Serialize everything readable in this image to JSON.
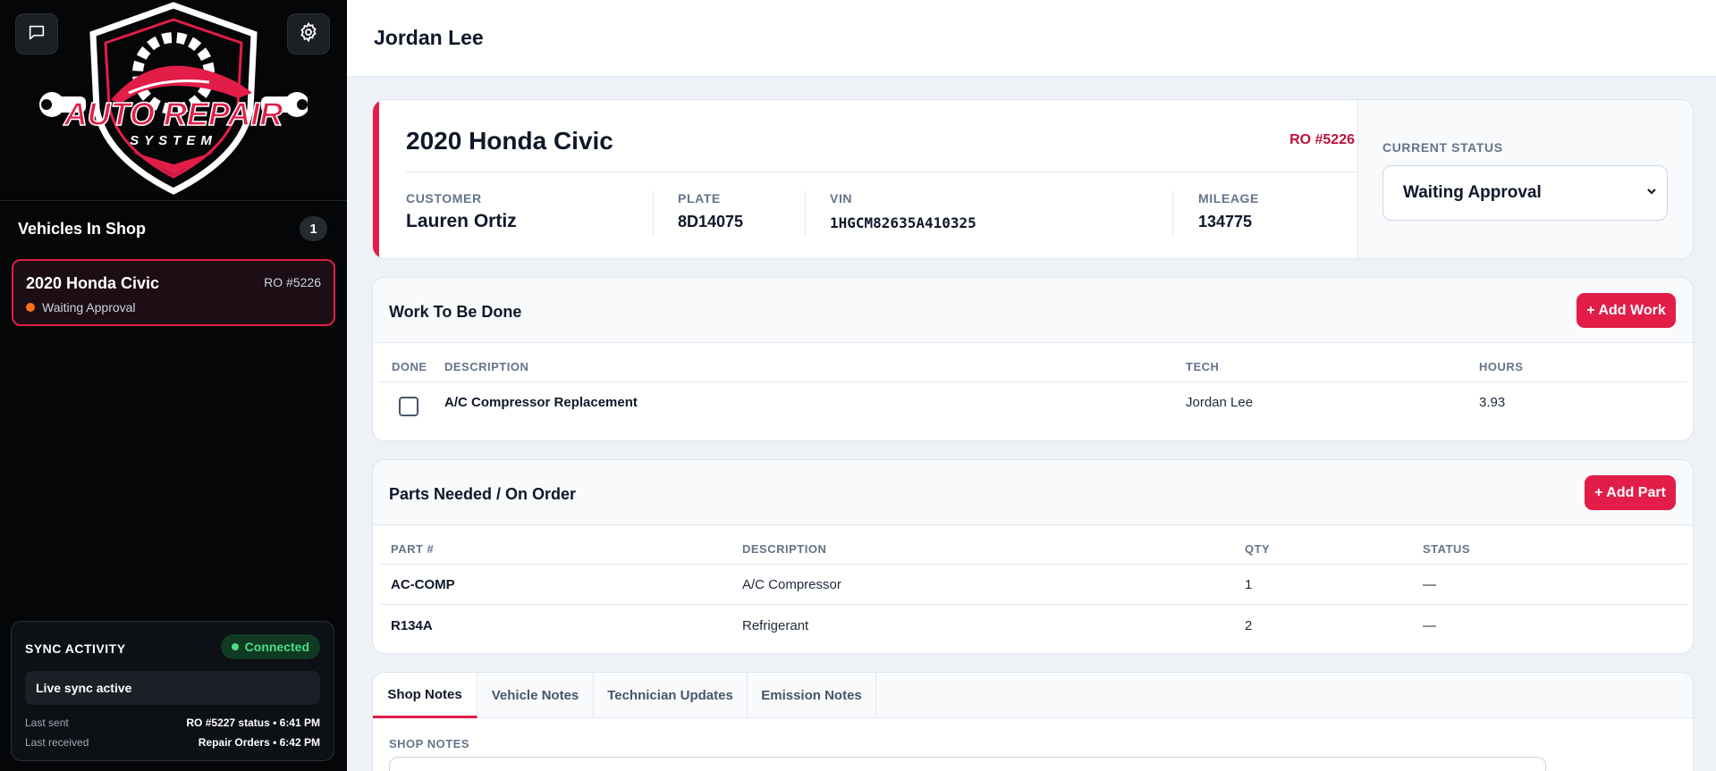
{
  "sidebar": {
    "logo": {
      "line1": "AUTO REPAIR",
      "line2": "SYSTEM"
    },
    "vehicles_title": "Vehicles In Shop",
    "vehicles_count": "1",
    "vehicles": [
      {
        "title": "2020 Honda Civic",
        "ro": "RO #5226",
        "status": "Waiting Approval"
      }
    ],
    "sync": {
      "title": "SYNC ACTIVITY",
      "badge": "Connected",
      "live": "Live sync active",
      "last_sent_label": "Last sent",
      "last_sent_value": "RO #5227 status • 6:41 PM",
      "last_received_label": "Last received",
      "last_received_value": "Repair Orders • 6:42 PM"
    }
  },
  "header": {
    "title": "Jordan Lee"
  },
  "vehicle": {
    "title": "2020 Honda Civic",
    "ro": "RO #5226",
    "customer_label": "CUSTOMER",
    "customer": "Lauren Ortiz",
    "plate_label": "PLATE",
    "plate": "8D14075",
    "vin_label": "VIN",
    "vin": "1HGCM82635A410325",
    "mileage_label": "MILEAGE",
    "mileage": "134775",
    "status_label": "CURRENT STATUS",
    "status": "Waiting Approval"
  },
  "work": {
    "title": "Work To Be Done",
    "add_label": "+ Add Work",
    "columns": [
      "DONE",
      "DESCRIPTION",
      "TECH",
      "HOURS"
    ],
    "rows": [
      {
        "done": false,
        "description": "A/C Compressor Replacement",
        "tech": "Jordan Lee",
        "hours": "3.93"
      }
    ]
  },
  "parts": {
    "title": "Parts Needed / On Order",
    "add_label": "+ Add Part",
    "columns": [
      "PART #",
      "DESCRIPTION",
      "QTY",
      "STATUS"
    ],
    "rows": [
      {
        "part": "AC-COMP",
        "description": "A/C Compressor",
        "qty": "1",
        "status": "—"
      },
      {
        "part": "R134A",
        "description": "Refrigerant",
        "qty": "2",
        "status": "—"
      }
    ]
  },
  "notes": {
    "tabs": [
      "Shop Notes",
      "Vehicle Notes",
      "Technician Updates",
      "Emission Notes"
    ],
    "active_tab": "Shop Notes",
    "label": "SHOP NOTES"
  },
  "colors": {
    "accent": "#e11d48",
    "sidebar_bg": "#050608",
    "status_dot": "#f97316",
    "connected": "#4ade80"
  }
}
